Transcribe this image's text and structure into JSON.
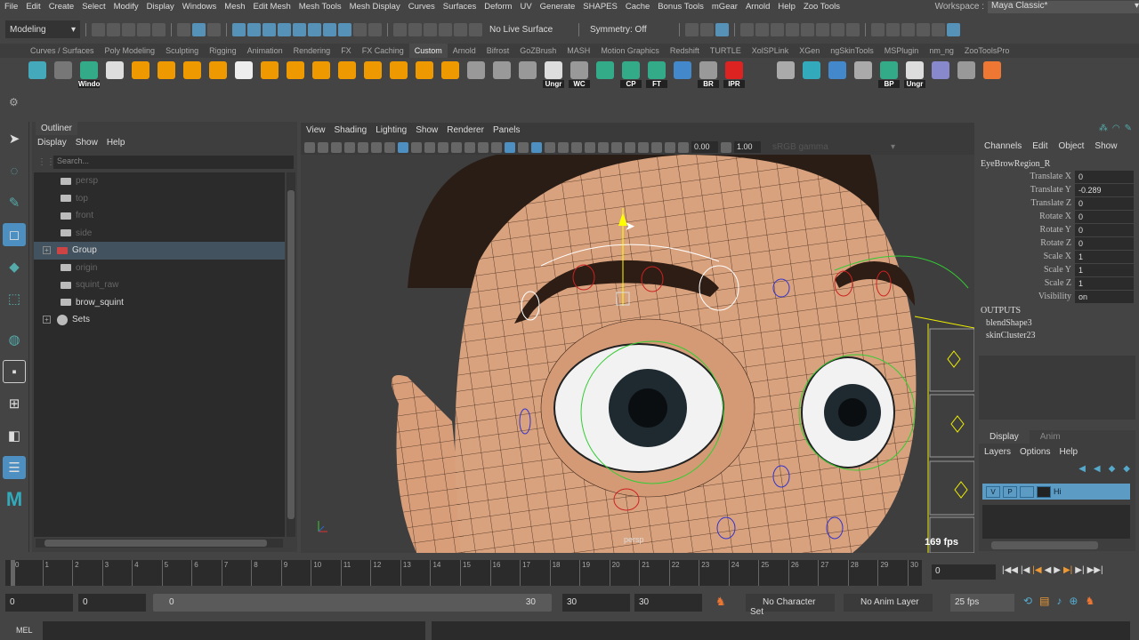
{
  "menubar": {
    "items": [
      "File",
      "Edit",
      "Create",
      "Select",
      "Modify",
      "Display",
      "Windows",
      "Mesh",
      "Edit Mesh",
      "Mesh Tools",
      "Mesh Display",
      "Curves",
      "Surfaces",
      "Deform",
      "UV",
      "Generate",
      "SHAPES",
      "Cache",
      "Bonus Tools",
      "mGear",
      "Arnold",
      "Help",
      "Zoo Tools"
    ],
    "workspace_label": "Workspace :",
    "workspace_value": "Maya Classic*"
  },
  "toolbar": {
    "mode": "Modeling",
    "live_surface": "No Live Surface",
    "symmetry": "Symmetry: Off"
  },
  "shelf": {
    "tabs": [
      "Curves / Surfaces",
      "Poly Modeling",
      "Sculpting",
      "Rigging",
      "Animation",
      "Rendering",
      "FX",
      "FX Caching",
      "Custom",
      "Arnold",
      "Bifrost",
      "GoZBrush",
      "MASH",
      "Motion Graphics",
      "Redshift",
      "TURTLE",
      "XolSPLink",
      "XGen",
      "ngSkinTools",
      "MSPlugin",
      "nm_ng",
      "ZooToolsPro"
    ],
    "active_tab": "Custom",
    "labels": {
      "windo": "Windo",
      "ungr": "Ungr",
      "wc": "WC",
      "cp": "CP",
      "ft": "FT",
      "br": "BR",
      "ipr": "IPR",
      "bp": "BP",
      "ungr2": "Ungr"
    }
  },
  "outliner": {
    "title": "Outliner",
    "menu": [
      "Display",
      "Show",
      "Help"
    ],
    "search_placeholder": "Search...",
    "items": [
      {
        "label": "persp",
        "dim": true
      },
      {
        "label": "top",
        "dim": true
      },
      {
        "label": "front",
        "dim": true
      },
      {
        "label": "side",
        "dim": true
      },
      {
        "label": "Group",
        "selected": true
      },
      {
        "label": "origin",
        "dim": true
      },
      {
        "label": "squint_raw",
        "dim": true
      },
      {
        "label": "brow_squint"
      },
      {
        "label": "Sets"
      }
    ]
  },
  "viewport": {
    "menu": [
      "View",
      "Shading",
      "Lighting",
      "Show",
      "Renderer",
      "Panels"
    ],
    "exposure": "0.00",
    "gamma": "1.00",
    "color_space": "sRGB gamma",
    "camera": "persp",
    "fps": "169 fps"
  },
  "channels": {
    "menu": [
      "Channels",
      "Edit",
      "Object",
      "Show"
    ],
    "object": "EyeBrowRegion_R",
    "attrs": [
      {
        "k": "Translate X",
        "v": "0"
      },
      {
        "k": "Translate Y",
        "v": "-0.289"
      },
      {
        "k": "Translate Z",
        "v": "0"
      },
      {
        "k": "Rotate X",
        "v": "0"
      },
      {
        "k": "Rotate Y",
        "v": "0"
      },
      {
        "k": "Rotate Z",
        "v": "0"
      },
      {
        "k": "Scale X",
        "v": "1"
      },
      {
        "k": "Scale Y",
        "v": "1"
      },
      {
        "k": "Scale Z",
        "v": "1"
      },
      {
        "k": "Visibility",
        "v": "on"
      }
    ],
    "outputs_label": "OUTPUTS",
    "outputs": [
      "blendShape3",
      "skinCluster23"
    ]
  },
  "layers": {
    "tabs": [
      "Display",
      "Anim"
    ],
    "menu": [
      "Layers",
      "Options",
      "Help"
    ],
    "row": {
      "v": "V",
      "p": "P",
      "name": "Hi"
    }
  },
  "timeline": {
    "ticks": [
      "0",
      "1",
      "2",
      "3",
      "4",
      "5",
      "6",
      "7",
      "8",
      "9",
      "10",
      "11",
      "12",
      "13",
      "14",
      "15",
      "16",
      "17",
      "18",
      "19",
      "20",
      "21",
      "22",
      "23",
      "24",
      "25",
      "26",
      "27",
      "28",
      "29",
      "30"
    ],
    "current_frame": "0"
  },
  "range": {
    "start": "0",
    "anim_start": "0",
    "bar_start": "0",
    "bar_end": "30",
    "end": "30",
    "anim_end": "30",
    "character_set": "No Character Set",
    "anim_layer": "No Anim Layer",
    "fps": "25 fps"
  },
  "command": {
    "label": "MEL"
  },
  "colors": {
    "accent": "#4d8fc0",
    "skin": "#d9a27e",
    "selection": "#43525f"
  }
}
